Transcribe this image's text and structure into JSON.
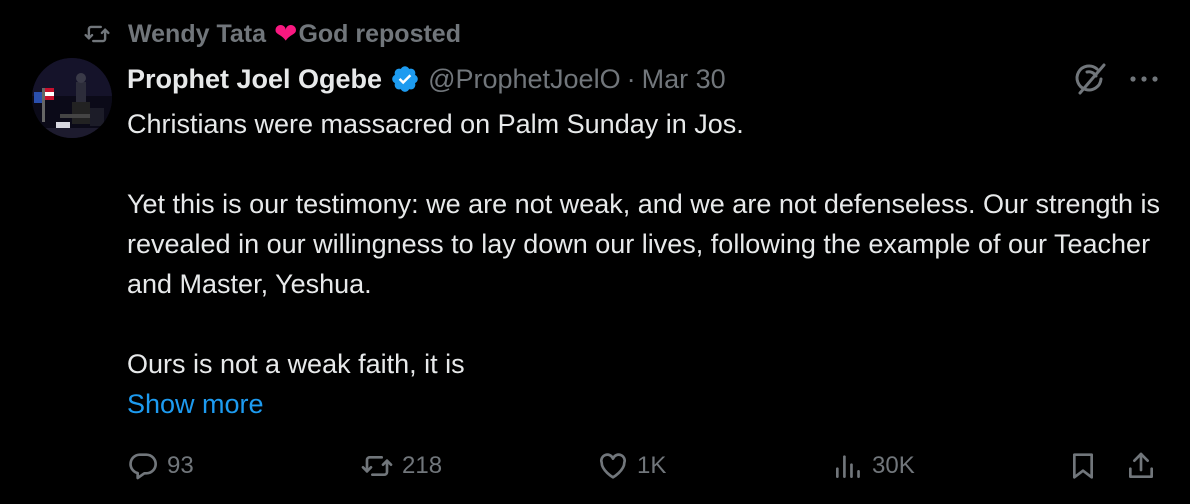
{
  "repost": {
    "user_before": "Wendy Tata",
    "user_after": "God reposted",
    "heart": "❤"
  },
  "author": {
    "name": "Prophet Joel Ogebe",
    "handle": "@ProphetJoelO",
    "separator": "·",
    "date": "Mar 30",
    "verified": true
  },
  "tweet": {
    "line1": "Christians were massacred on Palm Sunday in Jos.",
    "para2": "Yet this is our testimony: we are not weak, and we are not defenseless. Our strength is revealed in our willingness to lay down our lives, following the example of our Teacher and Master, Yeshua.",
    "para3": "Ours is not a weak faith, it is",
    "show_more": "Show more"
  },
  "actions": {
    "replies": "93",
    "reposts": "218",
    "likes": "1K",
    "views": "30K"
  },
  "colors": {
    "background": "#000000",
    "text": "#e7e9ea",
    "muted": "#71767b",
    "link": "#1d9bf0",
    "verified": "#1d9bf0",
    "heart": "#f91880"
  },
  "icons": [
    "repost-icon",
    "verified-badge-icon",
    "grok-icon",
    "more-icon",
    "reply-icon",
    "like-icon",
    "views-icon",
    "bookmark-icon",
    "share-icon"
  ]
}
